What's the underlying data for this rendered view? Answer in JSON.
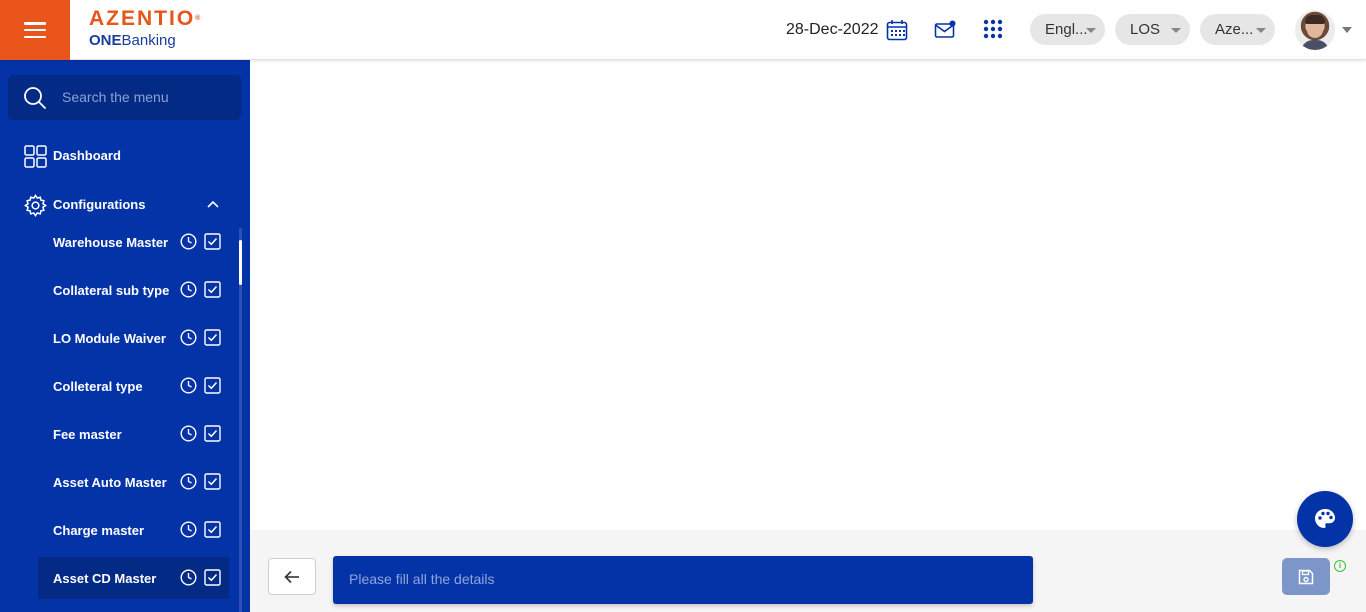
{
  "header": {
    "brand_name": "AZENTIO",
    "brand_tm": "®",
    "brand_sub_bold": "ONE",
    "brand_sub_rest": "Banking",
    "date": "28-Dec-2022",
    "language": "Engl...",
    "module": "LOS",
    "entity": "Aze...",
    "icons": [
      "menu-icon",
      "calendar-icon",
      "mail-icon",
      "apps-grid-icon",
      "avatar",
      "chevron-down-icon"
    ]
  },
  "sidebar": {
    "search_placeholder": "Search the menu",
    "dashboard_label": "Dashboard",
    "configurations_label": "Configurations",
    "items": [
      {
        "label": "Warehouse Master"
      },
      {
        "label": "Collateral sub type"
      },
      {
        "label": "LO Module Waiver"
      },
      {
        "label": "Colleteral type"
      },
      {
        "label": "Fee master"
      },
      {
        "label": "Asset Auto Master"
      },
      {
        "label": "Charge master"
      },
      {
        "label": "Asset CD Master"
      }
    ],
    "active_item": "Asset CD Master"
  },
  "footer": {
    "message": "Please fill all the details",
    "info_symbol": "i"
  },
  "colors": {
    "accent_orange": "#e8541a",
    "sidebar_blue": "#0433a8",
    "sidebar_dark": "#032b86",
    "save_button": "#7d96c9"
  }
}
